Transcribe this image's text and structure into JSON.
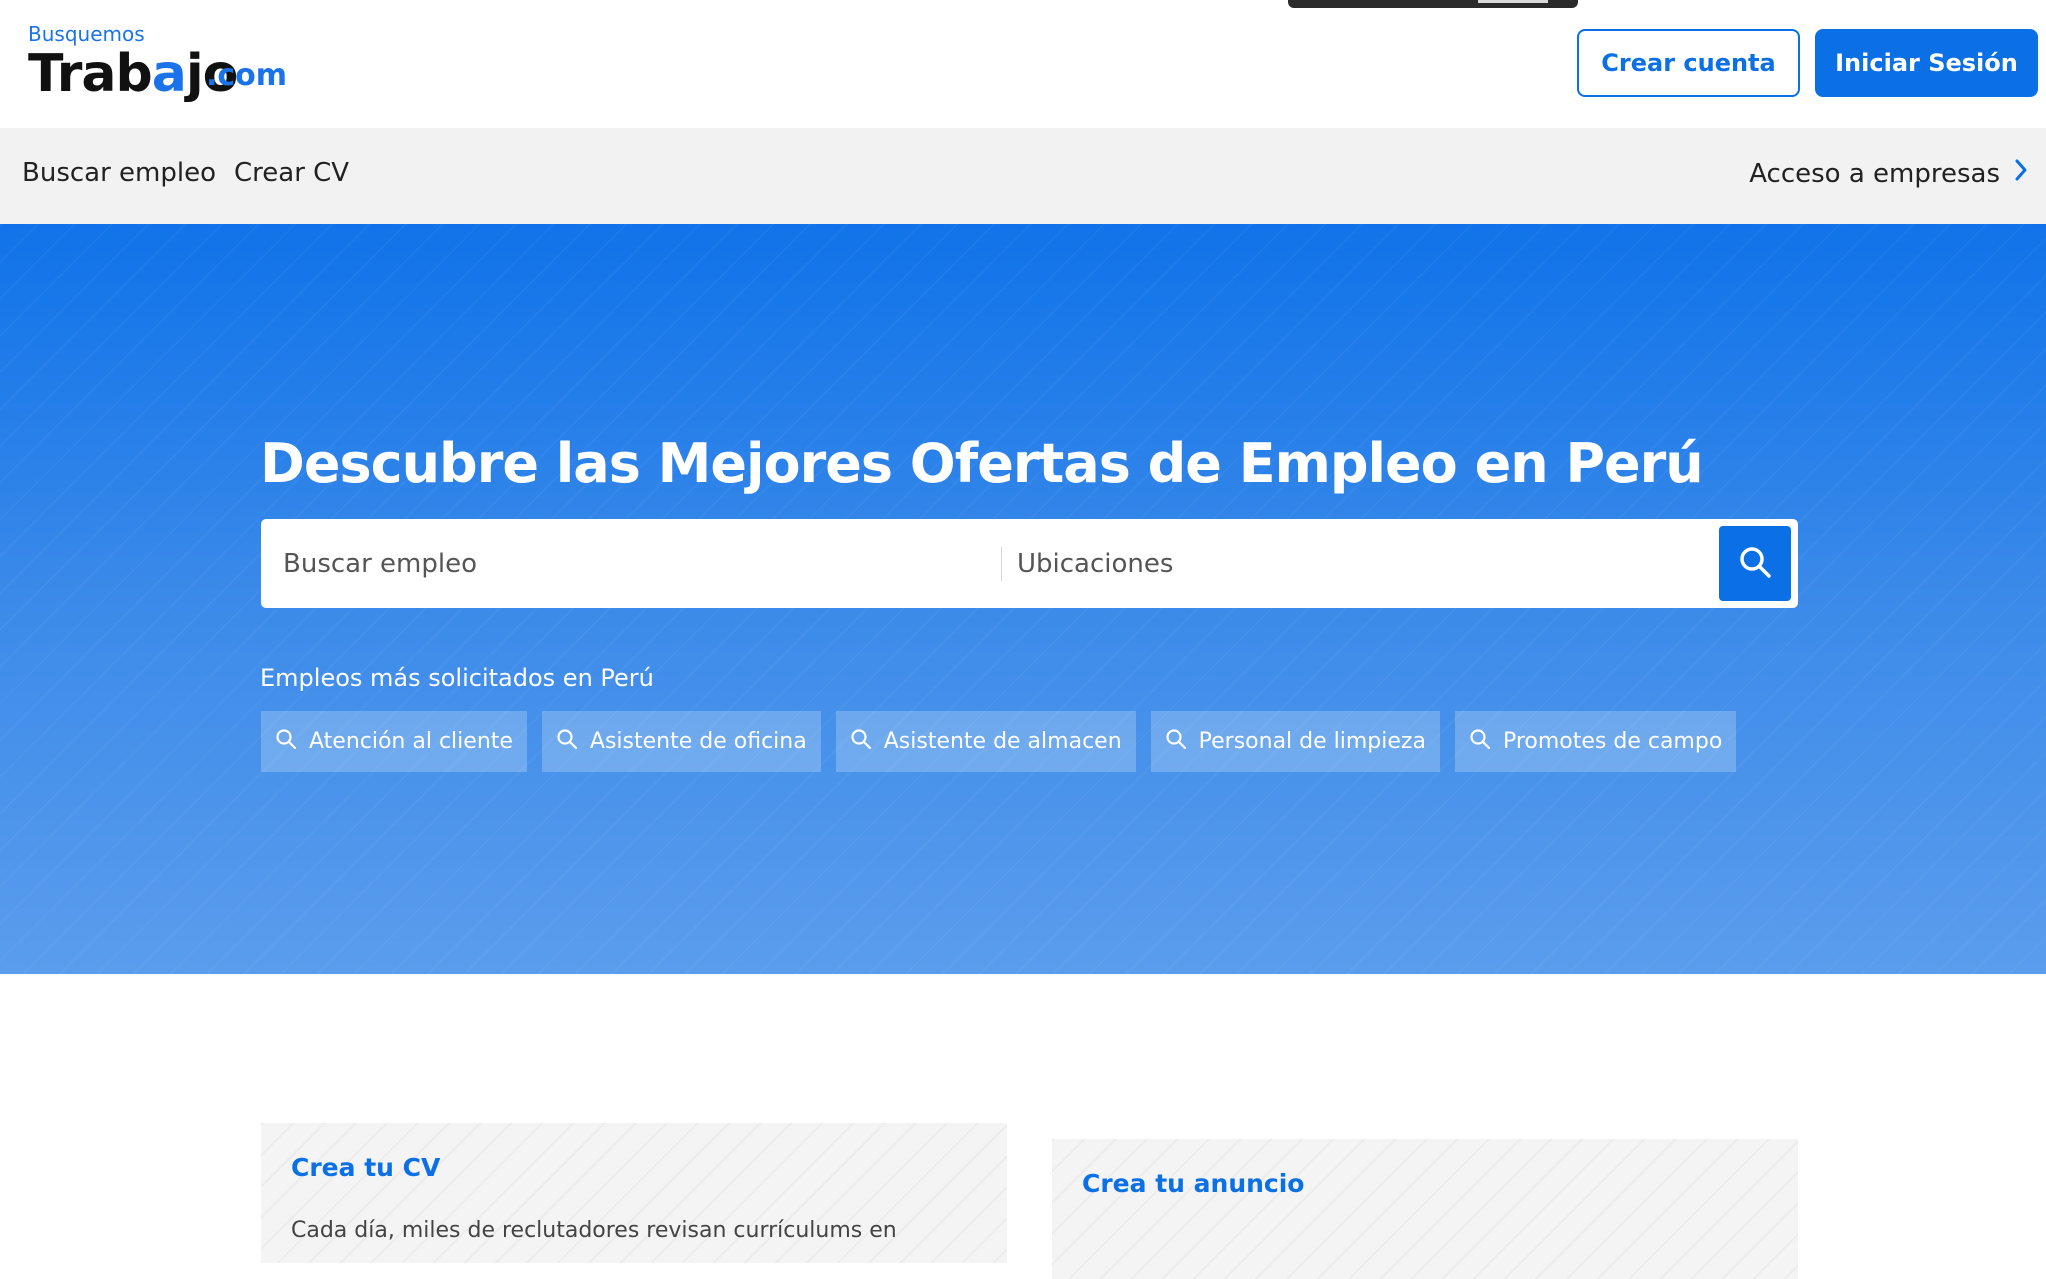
{
  "header": {
    "logo_top": "Busquemos",
    "logo_main_1": "Trab",
    "logo_main_o": "a",
    "logo_main_2": "jo",
    "logo_domain": ".com",
    "create_account_label": "Crear cuenta",
    "login_label": "Iniciar Sesión"
  },
  "nav": {
    "items": [
      {
        "label": "Buscar empleo"
      },
      {
        "label": "Crear CV"
      }
    ],
    "companies_label": "Acceso a empresas"
  },
  "hero": {
    "title": "Descubre las Mejores Ofertas de Empleo en Perú",
    "search": {
      "job_placeholder": "Buscar empleo",
      "location_placeholder": "Ubicaciones"
    },
    "popular_label": "Empleos más solicitados en Perú",
    "chips": [
      {
        "label": "Atención al cliente"
      },
      {
        "label": "Asistente de oficina"
      },
      {
        "label": "Asistente de almacen"
      },
      {
        "label": "Personal de limpieza"
      },
      {
        "label": "Promotes de campo"
      }
    ]
  },
  "cards": [
    {
      "title": "Crea tu CV",
      "text": "Cada día, miles de reclutadores revisan currículums en"
    },
    {
      "title": "Crea tu anuncio",
      "text": ""
    }
  ],
  "colors": {
    "primary": "#0b6fe6",
    "hero_top": "#1073e9",
    "hero_bottom": "#5a9ded",
    "nav_bg": "#f2f2f2"
  },
  "icons": {
    "search": "search-icon",
    "chevron": "chevron-right-icon"
  }
}
